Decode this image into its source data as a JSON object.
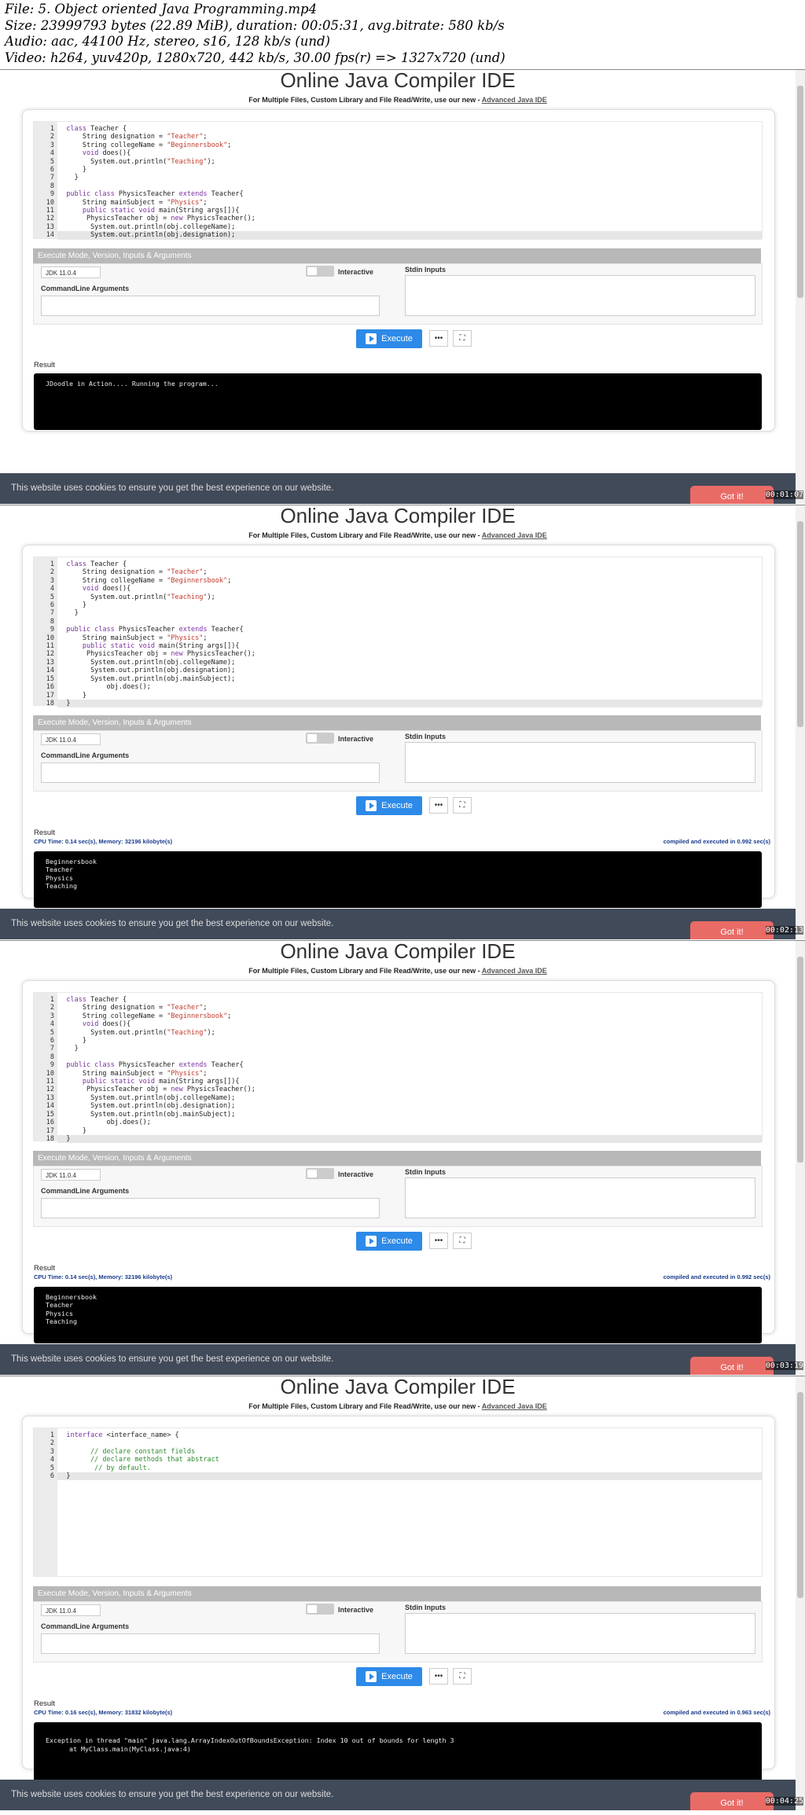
{
  "meta": {
    "line1": "File: 5. Object oriented Java Programming.mp4",
    "line2": "Size: 23999793 bytes (22.89 MiB), duration: 00:05:31, avg.bitrate: 580 kb/s",
    "line3": "Audio: aac, 44100 Hz, stereo, s16, 128 kb/s (und)",
    "line4": "Video: h264, yuv420p, 1280x720, 442 kb/s, 30.00 fps(r) => 1327x720 (und)"
  },
  "page": {
    "title": "Online Java Compiler IDE",
    "subtitle": "For Multiple Files, Custom Library and File Read/Write, use our new - ",
    "subtitle_link": "Advanced Java IDE",
    "exec_bar": "Execute Mode, Version, Inputs & Arguments",
    "jdk": "JDK 11.0.4",
    "interactive": "Interactive",
    "stdin": "Stdin Inputs",
    "cmdline": "CommandLine Arguments",
    "execute": "Execute",
    "more": "•••",
    "result": "Result",
    "cookie_text": "This website uses cookies to ensure you get the best experience on our website.",
    "got_it": "Got it!",
    "colors": {
      "accent": "#2d8ae8",
      "cookie_bg": "#414a59",
      "got_it": "#e96b66"
    }
  },
  "frames": [
    {
      "code": [
        {
          "n": "1",
          "t": [
            [
              "kw",
              "class"
            ],
            [
              "plain",
              " Teacher {"
            ]
          ]
        },
        {
          "n": "2",
          "t": [
            [
              "plain",
              "    String designation = "
            ],
            [
              "str",
              "\"Teacher\""
            ],
            [
              "plain",
              ";"
            ]
          ]
        },
        {
          "n": "3",
          "t": [
            [
              "plain",
              "    String collegeName = "
            ],
            [
              "str",
              "\"Beginnersbook\""
            ],
            [
              "plain",
              ";"
            ]
          ]
        },
        {
          "n": "4",
          "t": [
            [
              "plain",
              "    "
            ],
            [
              "kw",
              "void"
            ],
            [
              "plain",
              " does(){"
            ]
          ]
        },
        {
          "n": "5",
          "t": [
            [
              "plain",
              "      System.out.println("
            ],
            [
              "str",
              "\"Teaching\""
            ],
            [
              "plain",
              ");"
            ]
          ]
        },
        {
          "n": "6",
          "t": [
            [
              "plain",
              "    }"
            ]
          ]
        },
        {
          "n": "7",
          "t": [
            [
              "plain",
              "  }"
            ]
          ]
        },
        {
          "n": "8",
          "t": []
        },
        {
          "n": "9",
          "t": [
            [
              "kw",
              "public class"
            ],
            [
              "plain",
              " PhysicsTeacher "
            ],
            [
              "kw",
              "extends"
            ],
            [
              "plain",
              " Teacher{"
            ]
          ]
        },
        {
          "n": "10",
          "t": [
            [
              "plain",
              "    String mainSubject = "
            ],
            [
              "str",
              "\"Physics\""
            ],
            [
              "plain",
              ";"
            ]
          ]
        },
        {
          "n": "11",
          "t": [
            [
              "plain",
              "    "
            ],
            [
              "kw",
              "public static void"
            ],
            [
              "plain",
              " main(String args[]){"
            ]
          ]
        },
        {
          "n": "12",
          "t": [
            [
              "plain",
              "     PhysicsTeacher obj = "
            ],
            [
              "kw",
              "new"
            ],
            [
              "plain",
              " PhysicsTeacher();"
            ]
          ]
        },
        {
          "n": "13",
          "t": [
            [
              "plain",
              "      System.out.println(obj.collegeName);"
            ]
          ]
        },
        {
          "n": "14",
          "t": [
            [
              "plain",
              "      System.out.println(obj.designation);"
            ]
          ]
        }
      ],
      "cpu": "",
      "compiled": "",
      "output": [
        "JDoodle in Action.... Running the program..."
      ],
      "timestamp": "00:01:07"
    },
    {
      "code": [
        {
          "n": "1",
          "t": [
            [
              "kw",
              "class"
            ],
            [
              "plain",
              " Teacher {"
            ]
          ]
        },
        {
          "n": "2",
          "t": [
            [
              "plain",
              "    String designation = "
            ],
            [
              "str",
              "\"Teacher\""
            ],
            [
              "plain",
              ";"
            ]
          ]
        },
        {
          "n": "3",
          "t": [
            [
              "plain",
              "    String collegeName = "
            ],
            [
              "str",
              "\"Beginnersbook\""
            ],
            [
              "plain",
              ";"
            ]
          ]
        },
        {
          "n": "4",
          "t": [
            [
              "plain",
              "    "
            ],
            [
              "kw",
              "void"
            ],
            [
              "plain",
              " does(){"
            ]
          ]
        },
        {
          "n": "5",
          "t": [
            [
              "plain",
              "      System.out.println("
            ],
            [
              "str",
              "\"Teaching\""
            ],
            [
              "plain",
              ");"
            ]
          ]
        },
        {
          "n": "6",
          "t": [
            [
              "plain",
              "    }"
            ]
          ]
        },
        {
          "n": "7",
          "t": [
            [
              "plain",
              "  }"
            ]
          ]
        },
        {
          "n": "8",
          "t": []
        },
        {
          "n": "9",
          "t": [
            [
              "kw",
              "public class"
            ],
            [
              "plain",
              " PhysicsTeacher "
            ],
            [
              "kw",
              "extends"
            ],
            [
              "plain",
              " Teacher{"
            ]
          ]
        },
        {
          "n": "10",
          "t": [
            [
              "plain",
              "    String mainSubject = "
            ],
            [
              "str",
              "\"Physics\""
            ],
            [
              "plain",
              ";"
            ]
          ]
        },
        {
          "n": "11",
          "t": [
            [
              "plain",
              "    "
            ],
            [
              "kw",
              "public static void"
            ],
            [
              "plain",
              " main(String args[]){"
            ]
          ]
        },
        {
          "n": "12",
          "t": [
            [
              "plain",
              "     PhysicsTeacher obj = "
            ],
            [
              "kw",
              "new"
            ],
            [
              "plain",
              " PhysicsTeacher();"
            ]
          ]
        },
        {
          "n": "13",
          "t": [
            [
              "plain",
              "      System.out.println(obj.collegeName);"
            ]
          ]
        },
        {
          "n": "14",
          "t": [
            [
              "plain",
              "      System.out.println(obj.designation);"
            ]
          ]
        },
        {
          "n": "15",
          "t": [
            [
              "plain",
              "      System.out.println(obj.mainSubject);"
            ]
          ]
        },
        {
          "n": "16",
          "t": [
            [
              "plain",
              "          obj.does();"
            ]
          ]
        },
        {
          "n": "17",
          "t": [
            [
              "plain",
              "    }"
            ]
          ]
        },
        {
          "n": "18",
          "t": [
            [
              "plain",
              "}"
            ]
          ]
        }
      ],
      "cpu": "CPU Time: 0.14 sec(s), Memory: 32196 kilobyte(s)",
      "compiled": "compiled and executed in 0.992 sec(s)",
      "output": [
        "Beginnersbook",
        "Teacher",
        "Physics",
        "Teaching"
      ],
      "timestamp": "00:02:13"
    },
    {
      "code": [
        {
          "n": "1",
          "t": [
            [
              "kw",
              "class"
            ],
            [
              "plain",
              " Teacher {"
            ]
          ]
        },
        {
          "n": "2",
          "t": [
            [
              "plain",
              "    String designation = "
            ],
            [
              "str",
              "\"Teacher\""
            ],
            [
              "plain",
              ";"
            ]
          ]
        },
        {
          "n": "3",
          "t": [
            [
              "plain",
              "    String collegeName = "
            ],
            [
              "str",
              "\"Beginnersbook\""
            ],
            [
              "plain",
              ";"
            ]
          ]
        },
        {
          "n": "4",
          "t": [
            [
              "plain",
              "    "
            ],
            [
              "kw",
              "void"
            ],
            [
              "plain",
              " does(){"
            ]
          ]
        },
        {
          "n": "5",
          "t": [
            [
              "plain",
              "      System.out.println("
            ],
            [
              "str",
              "\"Teaching\""
            ],
            [
              "plain",
              ");"
            ]
          ]
        },
        {
          "n": "6",
          "t": [
            [
              "plain",
              "    }"
            ]
          ]
        },
        {
          "n": "7",
          "t": [
            [
              "plain",
              "  }"
            ]
          ]
        },
        {
          "n": "8",
          "t": []
        },
        {
          "n": "9",
          "t": [
            [
              "kw",
              "public class"
            ],
            [
              "plain",
              " PhysicsTeacher "
            ],
            [
              "kw",
              "extends"
            ],
            [
              "plain",
              " Teacher{"
            ]
          ]
        },
        {
          "n": "10",
          "t": [
            [
              "plain",
              "    String mainSubject = "
            ],
            [
              "str",
              "\"Physics\""
            ],
            [
              "plain",
              ";"
            ]
          ]
        },
        {
          "n": "11",
          "t": [
            [
              "plain",
              "    "
            ],
            [
              "kw",
              "public static void"
            ],
            [
              "plain",
              " main(String args[]){"
            ]
          ]
        },
        {
          "n": "12",
          "t": [
            [
              "plain",
              "     PhysicsTeacher obj = "
            ],
            [
              "kw",
              "new"
            ],
            [
              "plain",
              " PhysicsTeacher();"
            ]
          ]
        },
        {
          "n": "13",
          "t": [
            [
              "plain",
              "      System.out.println(obj.collegeName);"
            ]
          ]
        },
        {
          "n": "14",
          "t": [
            [
              "plain",
              "      System.out.println(obj.designation);"
            ]
          ]
        },
        {
          "n": "15",
          "t": [
            [
              "plain",
              "      System.out.println(obj.mainSubject);"
            ]
          ]
        },
        {
          "n": "16",
          "t": [
            [
              "plain",
              "          obj.does();"
            ]
          ]
        },
        {
          "n": "17",
          "t": [
            [
              "plain",
              "    }"
            ]
          ]
        },
        {
          "n": "18",
          "t": [
            [
              "plain",
              "}"
            ]
          ]
        }
      ],
      "cpu": "CPU Time: 0.14 sec(s), Memory: 32196 kilobyte(s)",
      "compiled": "compiled and executed in 0.992 sec(s)",
      "output": [
        "Beginnersbook",
        "Teacher",
        "Physics",
        "Teaching"
      ],
      "timestamp": "00:03:19"
    },
    {
      "code": [
        {
          "n": "1",
          "t": [
            [
              "kw",
              "interface"
            ],
            [
              "plain",
              " <interface_name> {"
            ]
          ]
        },
        {
          "n": "2",
          "t": []
        },
        {
          "n": "3",
          "t": [
            [
              "cmt",
              "      // declare constant fields"
            ]
          ]
        },
        {
          "n": "4",
          "t": [
            [
              "cmt",
              "      // declare methods that abstract"
            ]
          ]
        },
        {
          "n": "5",
          "t": [
            [
              "cmt",
              "       // by default."
            ]
          ]
        },
        {
          "n": "6",
          "t": [
            [
              "plain",
              "}"
            ]
          ]
        }
      ],
      "cpu": "CPU Time: 0.16 sec(s), Memory: 31832 kilobyte(s)",
      "compiled": "compiled and executed in 0.963 sec(s)",
      "output": [
        "",
        "Exception in thread \"main\" java.lang.ArrayIndexOutOfBoundsException: Index 10 out of bounds for length 3",
        "      at MyClass.main(MyClass.java:4)"
      ],
      "timestamp": "00:04:25"
    }
  ]
}
